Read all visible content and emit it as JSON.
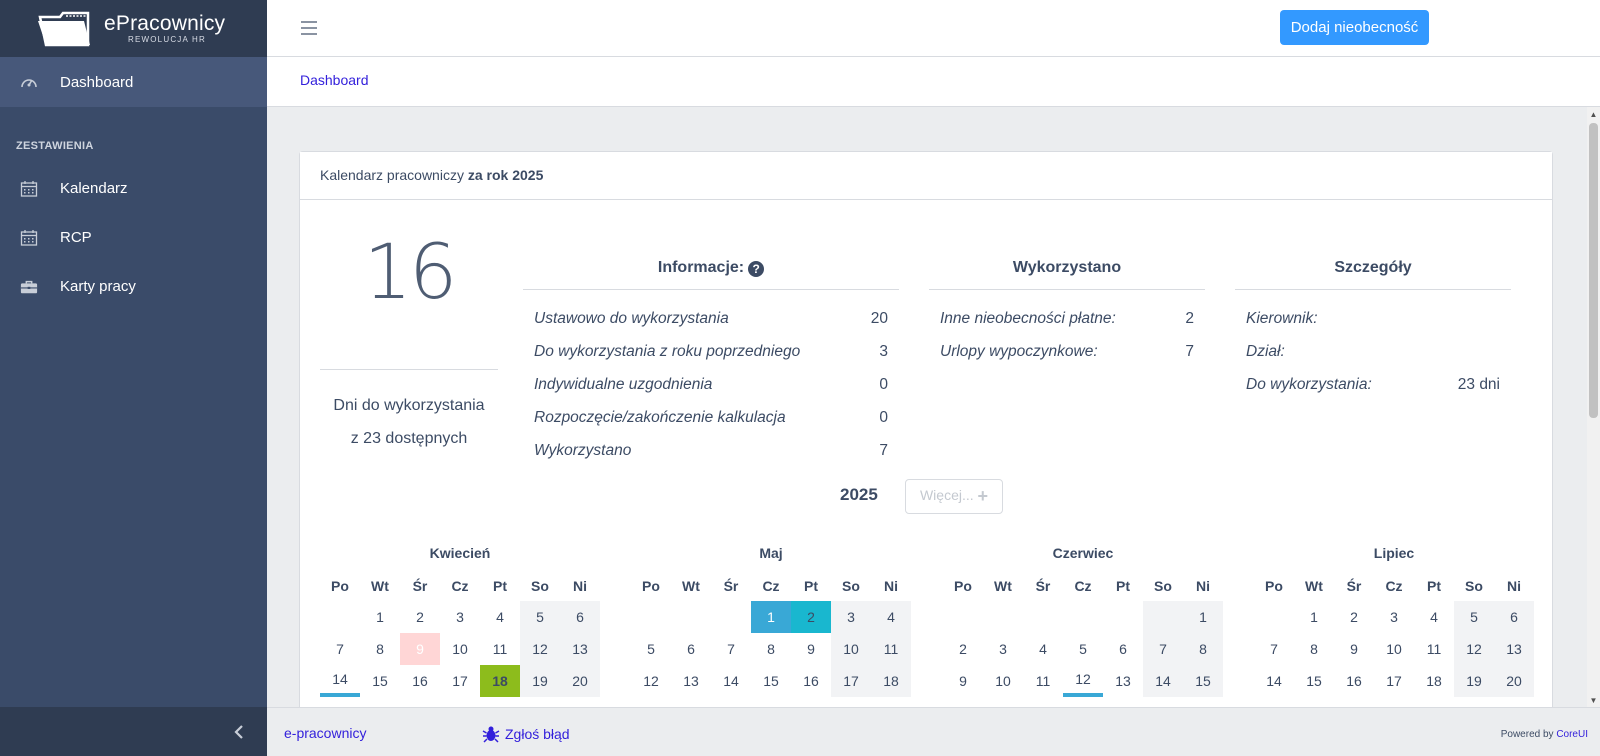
{
  "brand": {
    "name": "ePracownicy",
    "subtitle": "REWOLUCJA HR"
  },
  "sidebar": {
    "dashboard": "Dashboard",
    "section_title": "ZESTAWIENIA",
    "items": [
      {
        "label": "Kalendarz",
        "icon": "calendar-icon"
      },
      {
        "label": "RCP",
        "icon": "calendar-icon"
      },
      {
        "label": "Karty pracy",
        "icon": "briefcase-icon"
      }
    ]
  },
  "header": {
    "add_absence": "Dodaj nieobecność"
  },
  "breadcrumb": "Dashboard",
  "card": {
    "title_prefix": "Kalendarz pracowniczy ",
    "title_bold": "za rok 2025",
    "days_left": "16",
    "days_line1": "Dni do wykorzystania",
    "days_line2": "z 23 dostępnych",
    "info": {
      "heading": "Informacje:",
      "rows": [
        {
          "label": "Ustawowo do wykorzystania",
          "value": "20"
        },
        {
          "label": "Do wykorzystania z roku poprzedniego",
          "value": "3"
        },
        {
          "label": "Indywidualne uzgodnienia",
          "value": "0"
        },
        {
          "label": "Rozpoczęcie/zakończenie kalkulacja",
          "value": "0"
        },
        {
          "label": "Wykorzystano",
          "value": "7"
        }
      ]
    },
    "used": {
      "heading": "Wykorzystano",
      "rows": [
        {
          "label": "Inne nieobecności płatne:",
          "value": "2"
        },
        {
          "label": "Urlopy wypoczynkowe:",
          "value": "7"
        }
      ]
    },
    "details": {
      "heading": "Szczegóły",
      "rows": [
        {
          "label": "Kierownik:",
          "value": ""
        },
        {
          "label": "Dział:",
          "value": ""
        },
        {
          "label": "Do wykorzystania:",
          "value": "23 dni"
        }
      ]
    },
    "year": "2025",
    "more_button": "Więcej..."
  },
  "weekdays": [
    "Po",
    "Wt",
    "Śr",
    "Cz",
    "Pt",
    "So",
    "Ni"
  ],
  "months": [
    {
      "name": "Kwiecień",
      "rows": [
        [
          "",
          "1",
          "2",
          "3",
          "4",
          "5",
          "6"
        ],
        [
          "7",
          "8",
          "9",
          "10",
          "11",
          "12",
          "13"
        ],
        [
          "14",
          "15",
          "16",
          "17",
          "18",
          "19",
          "20"
        ]
      ],
      "marks": {
        "9": "hol",
        "18": "ok",
        "14": "und"
      }
    },
    {
      "name": "Maj",
      "rows": [
        [
          "",
          "",
          "",
          "1",
          "2",
          "3",
          "4"
        ],
        [
          "5",
          "6",
          "7",
          "8",
          "9",
          "10",
          "11"
        ],
        [
          "12",
          "13",
          "14",
          "15",
          "16",
          "17",
          "18"
        ]
      ],
      "marks": {
        "1": "vac",
        "2": "vac2"
      }
    },
    {
      "name": "Czerwiec",
      "rows": [
        [
          "",
          "",
          "",
          "",
          "",
          "",
          "1"
        ],
        [
          "2",
          "3",
          "4",
          "5",
          "6",
          "7",
          "8"
        ],
        [
          "9",
          "10",
          "11",
          "12",
          "13",
          "14",
          "15"
        ]
      ],
      "marks": {
        "12": "und"
      }
    },
    {
      "name": "Lipiec",
      "rows": [
        [
          "",
          "1",
          "2",
          "3",
          "4",
          "5",
          "6"
        ],
        [
          "7",
          "8",
          "9",
          "10",
          "11",
          "12",
          "13"
        ],
        [
          "14",
          "15",
          "16",
          "17",
          "18",
          "19",
          "20"
        ]
      ],
      "marks": {}
    }
  ],
  "footer": {
    "link1": "e-pracownicy",
    "link2": "Zgłoś błąd",
    "powered_prefix": "Powered by ",
    "powered_link": "CoreUI"
  },
  "colors": {
    "sidebar": "#3a4b69",
    "primary": "#3399ff",
    "link": "#321fdb",
    "holiday": "#ffd6d6",
    "approved": "#8dbc1c",
    "vacation": "#39a8d6"
  }
}
